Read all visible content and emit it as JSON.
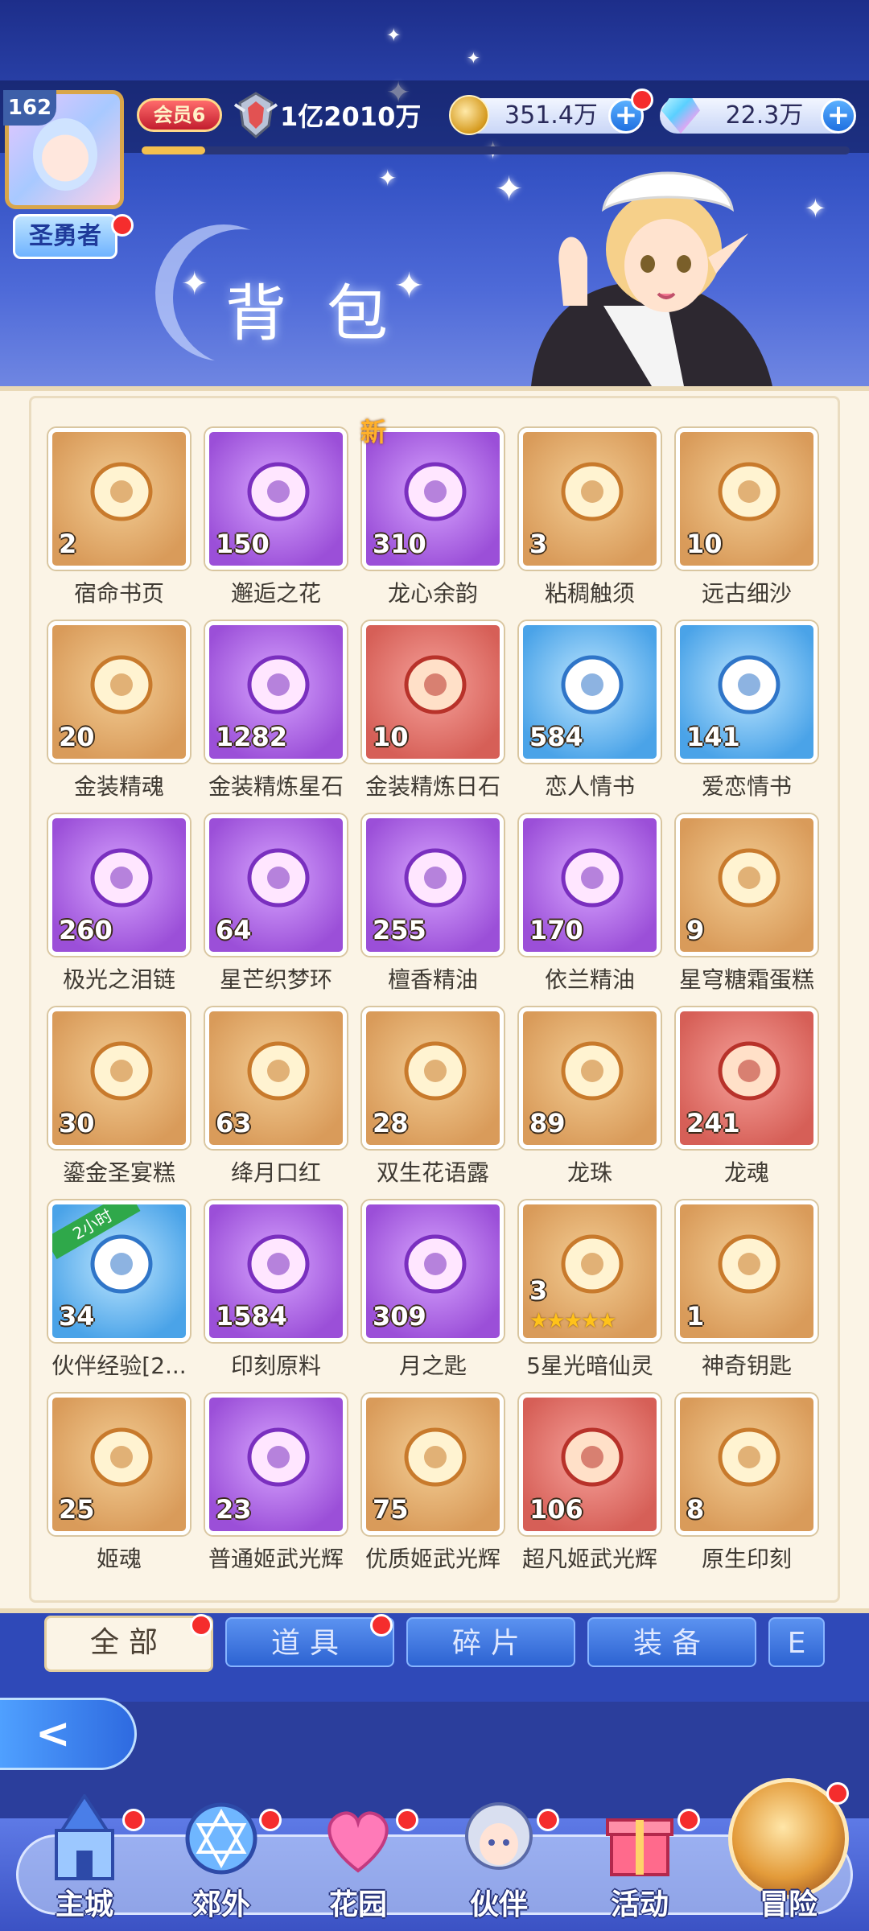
{
  "header": {
    "player_level": "162",
    "title_badge": "圣勇者",
    "vip": "会员6",
    "power": "1亿2010万",
    "exp_progress": 0.09,
    "gold": "351.4万",
    "diamond": "22.3万",
    "page_title": "背包"
  },
  "inventory": {
    "items": [
      {
        "name": "宿命书页",
        "count": "2",
        "rarity": "orange",
        "icon": "paper-icon"
      },
      {
        "name": "邂逅之花",
        "count": "150",
        "rarity": "purple",
        "icon": "rose-icon"
      },
      {
        "name": "龙心余韵",
        "count": "310",
        "rarity": "purple",
        "icon": "heart-crystal-icon",
        "tag": "新"
      },
      {
        "name": "粘稠触须",
        "count": "3",
        "rarity": "orange",
        "icon": "tentacle-icon"
      },
      {
        "name": "远古细沙",
        "count": "10",
        "rarity": "orange",
        "icon": "sand-pile-icon"
      },
      {
        "name": "金装精魂",
        "count": "20",
        "rarity": "orange",
        "icon": "gold-soul-icon"
      },
      {
        "name": "金装精炼星石",
        "count": "1282",
        "rarity": "purple",
        "icon": "star-stone-icon"
      },
      {
        "name": "金装精炼日石",
        "count": "10",
        "rarity": "red",
        "icon": "sun-stone-icon"
      },
      {
        "name": "恋人情书",
        "count": "584",
        "rarity": "blue",
        "icon": "love-letter-icon"
      },
      {
        "name": "爱恋情书",
        "count": "141",
        "rarity": "blue",
        "icon": "rose-letter-icon"
      },
      {
        "name": "极光之泪链",
        "count": "260",
        "rarity": "purple",
        "icon": "necklace-icon"
      },
      {
        "name": "星芒织梦环",
        "count": "64",
        "rarity": "purple",
        "icon": "bracelet-icon"
      },
      {
        "name": "檀香精油",
        "count": "255",
        "rarity": "purple",
        "icon": "oil-bottle-icon"
      },
      {
        "name": "依兰精油",
        "count": "170",
        "rarity": "purple",
        "icon": "perfume-bottle-icon"
      },
      {
        "name": "星穹糖霜蛋糕",
        "count": "9",
        "rarity": "orange",
        "icon": "cake-icon"
      },
      {
        "name": "鎏金圣宴糕",
        "count": "30",
        "rarity": "orange",
        "icon": "roll-cake-icon"
      },
      {
        "name": "绛月口红",
        "count": "63",
        "rarity": "orange",
        "icon": "lipstick-icon"
      },
      {
        "name": "双生花语露",
        "count": "28",
        "rarity": "orange",
        "icon": "dew-bottle-icon"
      },
      {
        "name": "龙珠",
        "count": "89",
        "rarity": "orange",
        "icon": "dragon-orb-icon"
      },
      {
        "name": "龙魂",
        "count": "241",
        "rarity": "red",
        "icon": "dragon-soul-icon"
      },
      {
        "name": "伙伴经验[2...",
        "count": "34",
        "rarity": "blue",
        "icon": "treasure-chest-icon",
        "tag": "2小时"
      },
      {
        "name": "印刻原料",
        "count": "1584",
        "rarity": "purple",
        "icon": "egg-material-icon"
      },
      {
        "name": "月之匙",
        "count": "309",
        "rarity": "purple",
        "icon": "moon-key-icon"
      },
      {
        "name": "5星光暗仙灵",
        "count": "3",
        "rarity": "orange",
        "icon": "fairy-icon",
        "stars": "★★★★★"
      },
      {
        "name": "神奇钥匙",
        "count": "1",
        "rarity": "orange",
        "icon": "key-icon"
      },
      {
        "name": "姬魂",
        "count": "25",
        "rarity": "orange",
        "icon": "purple-flame-icon"
      },
      {
        "name": "普通姬武光辉",
        "count": "23",
        "rarity": "purple",
        "icon": "purple-gem-icon"
      },
      {
        "name": "优质姬武光辉",
        "count": "75",
        "rarity": "orange",
        "icon": "orange-gem-icon"
      },
      {
        "name": "超凡姬武光辉",
        "count": "106",
        "rarity": "red",
        "icon": "red-gem-icon"
      },
      {
        "name": "原生印刻",
        "count": "8",
        "rarity": "orange",
        "icon": "crystal-icon"
      }
    ]
  },
  "tabs": [
    "全部",
    "道具",
    "碎片",
    "装备",
    "E"
  ],
  "nav": [
    "主城",
    "郊外",
    "花园",
    "伙伴",
    "活动",
    "冒险"
  ],
  "colors": {
    "accent_red": "#f52d2d",
    "panel_bg": "#fbf4e6",
    "header_blue": "#3452c4"
  }
}
